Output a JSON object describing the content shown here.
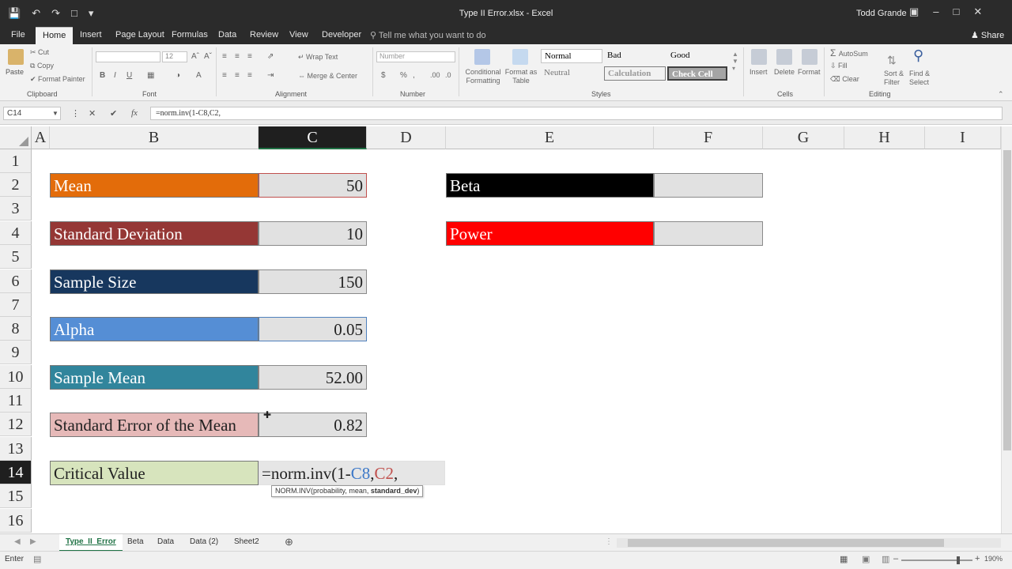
{
  "window": {
    "title": "Type II Error.xlsx - Excel",
    "user": "Todd Grande"
  },
  "ribbon_tabs": [
    "File",
    "Home",
    "Insert",
    "Page Layout",
    "Formulas",
    "Data",
    "Review",
    "View",
    "Developer"
  ],
  "tell_me": "Tell me what you want to do",
  "share_label": "Share",
  "ribbon": {
    "clipboard": {
      "paste": "Paste",
      "cut": "Cut",
      "copy": "Copy",
      "format_painter": "Format Painter",
      "group": "Clipboard"
    },
    "font": {
      "size": "12",
      "group": "Font"
    },
    "alignment": {
      "wrap": "Wrap Text",
      "merge": "Merge & Center",
      "group": "Alignment"
    },
    "number": {
      "format": "Number",
      "group": "Number"
    },
    "styles": {
      "conditional": "Conditional Formatting",
      "format_as_table": "Format as Table",
      "normal": "Normal",
      "bad": "Bad",
      "good": "Good",
      "neutral": "Neutral",
      "calculation": "Calculation",
      "check_cell": "Check Cell",
      "group": "Styles"
    },
    "cells": {
      "insert": "Insert",
      "delete": "Delete",
      "format": "Format",
      "group": "Cells"
    },
    "editing": {
      "autosum": "AutoSum",
      "fill": "Fill",
      "clear": "Clear",
      "sort": "Sort & Filter",
      "find": "Find & Select",
      "group": "Editing"
    }
  },
  "name_box": "C14",
  "formula_bar": "=norm.inv(1-C8,C2,",
  "columns": [
    "A",
    "B",
    "C",
    "D",
    "E",
    "F",
    "G",
    "H",
    "I"
  ],
  "selected_column": "C",
  "rows": [
    "1",
    "2",
    "3",
    "4",
    "5",
    "6",
    "7",
    "8",
    "9",
    "10",
    "11",
    "12",
    "13",
    "14",
    "15",
    "16"
  ],
  "selected_row": "14",
  "cells": {
    "mean": {
      "label": "Mean",
      "value": "50",
      "color": "#e36c0a"
    },
    "sd": {
      "label": "Standard Deviation",
      "value": "10",
      "color": "#953735"
    },
    "n": {
      "label": "Sample Size",
      "value": "150",
      "color": "#17375e"
    },
    "alpha": {
      "label": "Alpha",
      "value": "0.05",
      "color": "#558ed5"
    },
    "sample_mean": {
      "label": "Sample Mean",
      "value": "52.00",
      "color": "#31859c"
    },
    "sem": {
      "label": "Standard Error of the Mean",
      "value": "0.82",
      "color": "#e6b9b8"
    },
    "critical": {
      "label": "Critical Value",
      "color": "#d7e4bd"
    },
    "beta": {
      "label": "Beta",
      "color": "#000000"
    },
    "power": {
      "label": "Power",
      "color": "#ff0000"
    }
  },
  "edit_formula": {
    "prefix": "=norm.inv(1-",
    "ref1": "C8",
    "sep": ",",
    "ref2": "C2",
    "suffix": ","
  },
  "tooltip": {
    "text": "NORM.INV(probability, mean, ",
    "bold": "standard_dev",
    "close": ")"
  },
  "sheets": [
    "Type_II_Error",
    "Beta",
    "Data",
    "Data (2)",
    "Sheet2"
  ],
  "active_sheet": "Type_II_Error",
  "status": {
    "mode": "Enter",
    "zoom": "190%"
  }
}
